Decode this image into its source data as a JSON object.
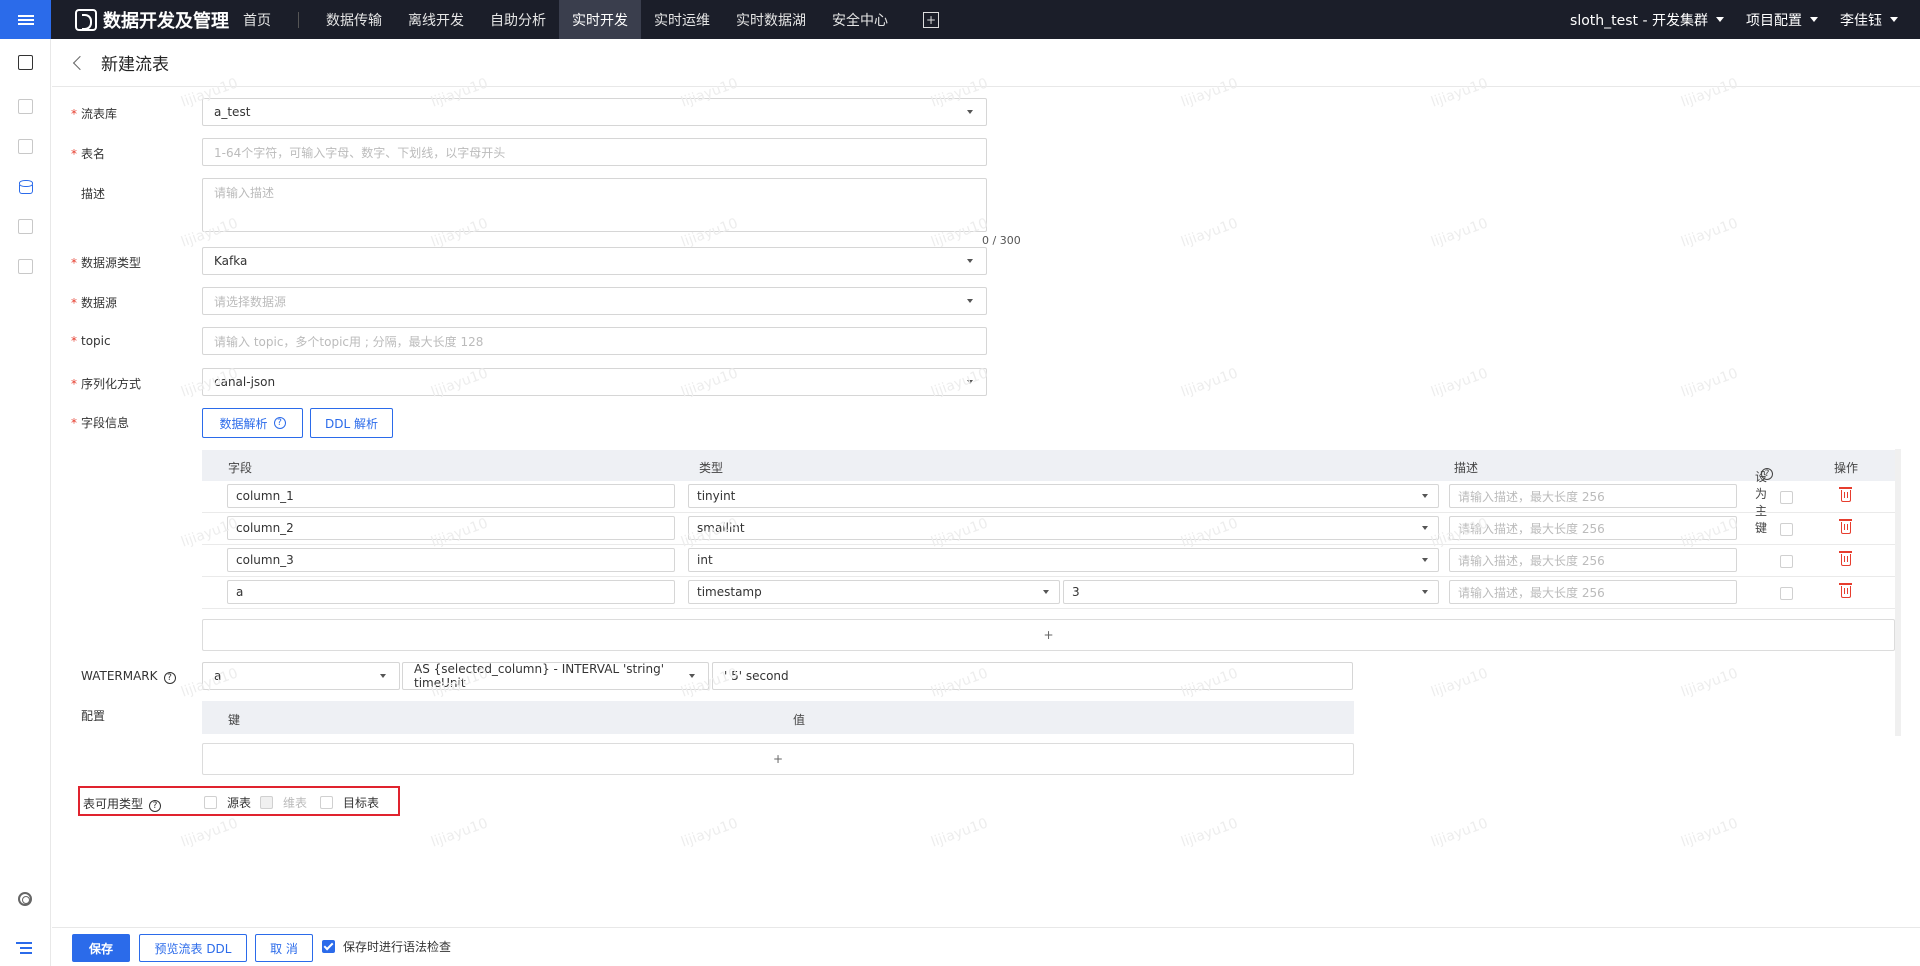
{
  "nav": {
    "brand": "数据开发及管理",
    "items": [
      "首页",
      "数据传输",
      "离线开发",
      "自助分析",
      "实时开发",
      "实时运维",
      "实时数据湖",
      "安全中心"
    ],
    "active_index": 4,
    "cluster": "sloth_test - 开发集群",
    "project_config": "项目配置",
    "user": "李佳钰"
  },
  "header": {
    "title": "新建流表"
  },
  "form": {
    "stream_db": {
      "label": "流表库",
      "value": "a_test"
    },
    "table_name": {
      "label": "表名",
      "placeholder": "1-64个字符，可输入字母、数字、下划线，以字母开头"
    },
    "description": {
      "label": "描述",
      "placeholder": "请输入描述",
      "counter": "0 / 300"
    },
    "source_type": {
      "label": "数据源类型",
      "value": "Kafka"
    },
    "source": {
      "label": "数据源",
      "placeholder": "请选择数据源"
    },
    "topic": {
      "label": "topic",
      "placeholder": "请输入 topic，多个topic用 ; 分隔，最大长度 128"
    },
    "serialization": {
      "label": "序列化方式",
      "value": "canal-json"
    },
    "fields_label": "字段信息",
    "parse_data_btn": "数据解析",
    "ddl_parse_btn": "DDL 解析"
  },
  "fields_table": {
    "headers": {
      "field": "字段",
      "type": "类型",
      "desc": "描述",
      "primary": "设为主键",
      "action": "操作"
    },
    "rows": [
      {
        "name": "column_1",
        "type": "tinyint",
        "desc_placeholder": "请输入描述，最大长度 256"
      },
      {
        "name": "column_2",
        "type": "smallint",
        "desc_placeholder": "请输入描述，最大长度 256"
      },
      {
        "name": "column_3",
        "type": "int",
        "desc_placeholder": "请输入描述，最大长度 256"
      },
      {
        "name": "a",
        "type": "timestamp",
        "precision": "3",
        "desc_placeholder": "请输入描述，最大长度 256"
      }
    ],
    "add_symbol": "+"
  },
  "watermark": {
    "label": "WATERMARK",
    "column": "a",
    "expression": "AS {selected_column} - INTERVAL 'string' timeUnit",
    "interval": "' 5' second"
  },
  "config": {
    "label": "配置",
    "key_header": "键",
    "value_header": "值",
    "add_symbol": "+"
  },
  "available_types": {
    "label": "表可用类型",
    "options": [
      {
        "label": "源表",
        "checked": false,
        "disabled": false
      },
      {
        "label": "维表",
        "checked": false,
        "disabled": true
      },
      {
        "label": "目标表",
        "checked": false,
        "disabled": false
      }
    ]
  },
  "footer": {
    "save": "保存",
    "preview_ddl": "预览流表 DDL",
    "cancel": "取 消",
    "syntax_check": "保存时进行语法检查",
    "syntax_check_checked": true
  },
  "watermark_text": "lijiayu10"
}
